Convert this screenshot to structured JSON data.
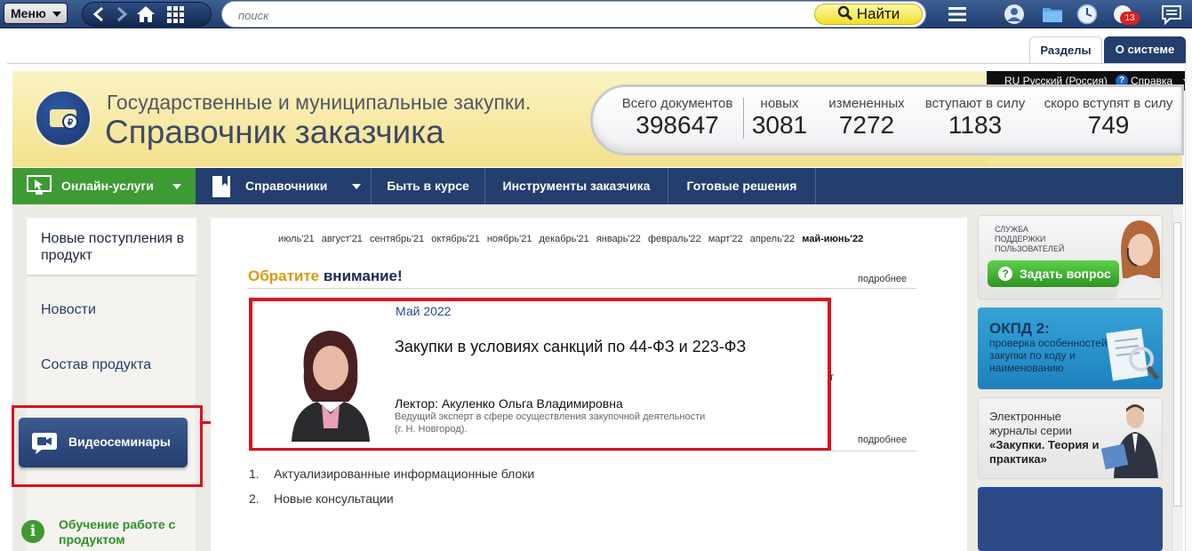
{
  "topbar": {
    "menu_label": "Меню",
    "search_placeholder": "поиск",
    "find_label": "Найти",
    "notifications_count": "13"
  },
  "tabs": {
    "sections": "Разделы",
    "about": "О системе"
  },
  "langbar": {
    "language": "RU Русский (Россия)",
    "help": "Справка"
  },
  "header": {
    "subtitle": "Государственные и муниципальные закупки.",
    "title": "Справочник заказчика"
  },
  "stats": [
    {
      "label": "Всего документов",
      "value": "398647"
    },
    {
      "label": "новых",
      "value": "3081"
    },
    {
      "label": "измененных",
      "value": "7272"
    },
    {
      "label": "вступают в силу",
      "value": "1183"
    },
    {
      "label": "скоро вступят в силу",
      "value": "749"
    }
  ],
  "nav": {
    "online_services": "Онлайн-услуги",
    "references": "Справочники",
    "stay_informed": "Быть в курсе",
    "customer_tools": "Инструменты заказчика",
    "ready_solutions": "Готовые решения"
  },
  "sidebar": {
    "new_in_product": "Новые поступления в продукт",
    "news": "Новости",
    "product_contents": "Состав продукта",
    "video_seminars": "Видеосеминары",
    "training": "Обучение работе с продуктом"
  },
  "months": [
    "июль'21",
    "август'21",
    "сентябрь'21",
    "октябрь'21",
    "ноябрь'21",
    "декабрь'21",
    "январь'22",
    "февраль'22",
    "март'22",
    "апрель'22",
    "май-июнь'22"
  ],
  "attention": {
    "accent": "Обратите",
    "rest": "внимание!",
    "more_top": "подробнее",
    "more_bottom": "подробнее"
  },
  "card": {
    "date": "Май 2022",
    "title": "Закупки в условиях санкций по 44-ФЗ и 223-ФЗ",
    "lecturer": "Лектор: Акуленко Ольга Владимировна",
    "role_line1": "Ведущий эксперт в сфере осуществления закупочной деятельности",
    "role_line2": "(г. Н. Новгород).",
    "stray_char": "г"
  },
  "list": [
    {
      "num": "1.",
      "text": "Актуализированные информационные блоки"
    },
    {
      "num": "2.",
      "text": "Новые консультации"
    }
  ],
  "banners": {
    "support_small": "СЛУЖБА ПОДДЕРЖКИ ПОЛЬЗОВАТЕЛЕЙ",
    "ask_question": "Задать вопрос",
    "okpd_title": "ОКПД 2:",
    "okpd_text": "проверка особенностей закупки по коду и наименованию",
    "journals_line1": "Электронные журналы серии",
    "journals_bold": "«Закупки. Теория и практика»"
  },
  "colors": {
    "nav_bg": "#243e6e",
    "online_green": "#3e9a34",
    "highlight_red": "#d8121f",
    "accent_orange": "#d99a12"
  }
}
